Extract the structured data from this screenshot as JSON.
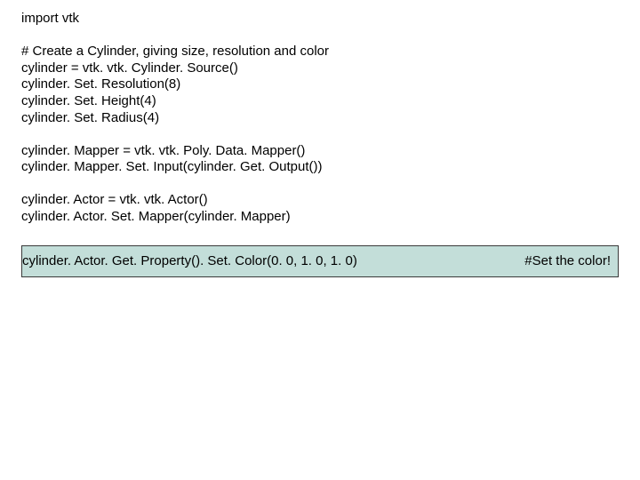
{
  "code": {
    "line1": "import vtk",
    "line2": "# Create a Cylinder, giving size, resolution and color",
    "line3": "cylinder = vtk. vtk. Cylinder. Source()",
    "line4": "cylinder. Set. Resolution(8)",
    "line5": "cylinder. Set. Height(4)",
    "line6": "cylinder. Set. Radius(4)",
    "line7": "cylinder. Mapper = vtk. vtk. Poly. Data. Mapper()",
    "line8": "cylinder. Mapper. Set. Input(cylinder. Get. Output())",
    "line9": "cylinder. Actor = vtk. vtk. Actor()",
    "line10": "cylinder. Actor. Set. Mapper(cylinder. Mapper)"
  },
  "highlight": {
    "left": "cylinder. Actor. Get. Property(). Set. Color(0. 0, 1. 0, 1. 0)",
    "right": "#Set the color!"
  }
}
